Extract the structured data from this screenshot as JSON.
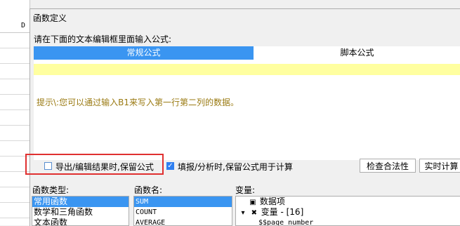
{
  "sheet": {
    "column_header": "D"
  },
  "dialog": {
    "title": "函数定义",
    "prompt": "请在下面的文本编辑框里面输入公式:",
    "tabs": [
      {
        "label": "常规公式",
        "active": true
      },
      {
        "label": "脚本公式",
        "active": false
      }
    ],
    "editor": {
      "hint": "提示\\:您可以通过输入B1来写入第一行第二列的数据。",
      "hint_color": "#9a7a12"
    },
    "options": {
      "keep_formula_export": {
        "label": "导出/编辑结果时,保留公式",
        "checked": false
      },
      "keep_formula_fill": {
        "label": "填报/分析时,保留公式用于计算",
        "checked": true
      }
    },
    "buttons": {
      "check_validity": "检查合法性",
      "realtime_calc": "实时计算"
    },
    "panels": {
      "function_type_label": "函数类型:",
      "function_name_label": "函数名:",
      "variable_label": "变量:",
      "function_types": [
        "常用函数",
        "数学和三角函数",
        "文本函数"
      ],
      "function_names": [
        "SUM",
        "COUNT",
        "AVERAGE"
      ],
      "variables": [
        {
          "icon": "dataset-icon",
          "label": "数据项"
        },
        {
          "icon": "variable-icon",
          "label": "变量 - [16]"
        },
        {
          "icon": "",
          "label": "$$page_number"
        }
      ]
    },
    "accent_color": "#3a95f1",
    "highlight_box_color": "#e03030"
  }
}
